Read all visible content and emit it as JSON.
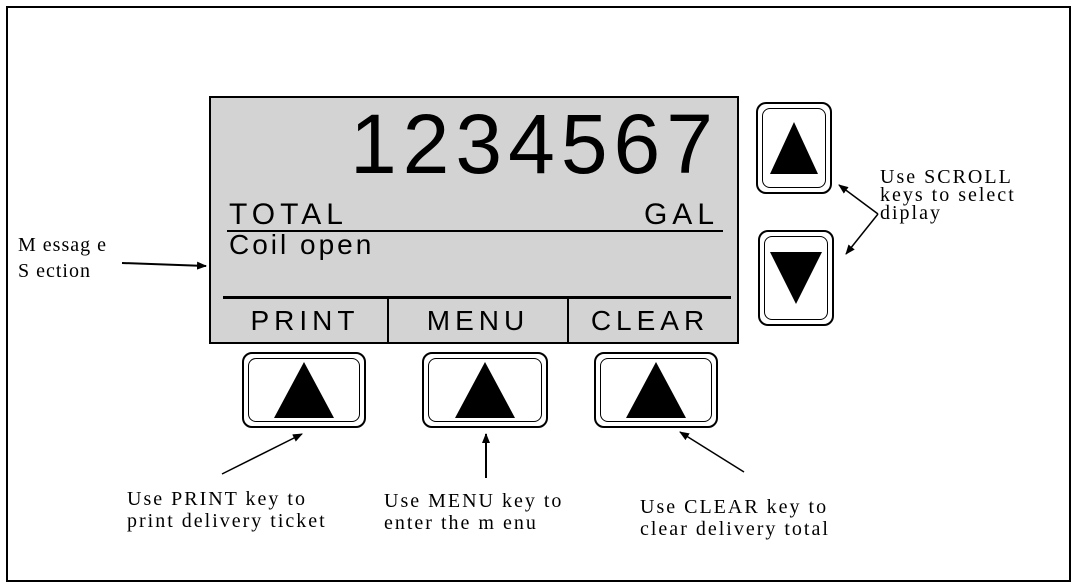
{
  "display": {
    "counter": "1234567",
    "total_label": "TOTAL",
    "unit_label": "GAL",
    "message": "Coil open",
    "softkeys": [
      "PRINT",
      "MENU",
      "CLEAR"
    ]
  },
  "annotations": {
    "message_section": [
      "M essag e",
      "S ection"
    ],
    "scroll_keys": [
      "Use SCROLL",
      "keys to select",
      "diplay"
    ],
    "print_key": [
      "Use PRINT key to",
      "print delivery ticket"
    ],
    "menu_key": [
      "Use MENU key to",
      "enter the m enu"
    ],
    "clear_key": [
      "Use CLEAR key to",
      "clear delivery total"
    ]
  }
}
